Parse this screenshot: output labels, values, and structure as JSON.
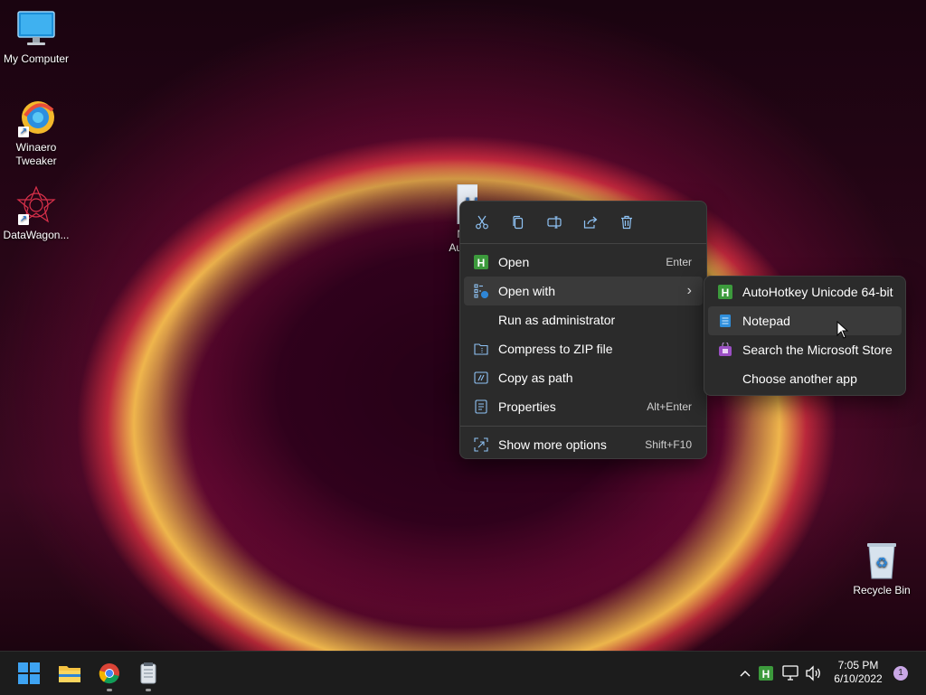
{
  "desktop": {
    "icons": [
      {
        "label": "My Computer",
        "icon": "monitor-icon"
      },
      {
        "label": "Winaero\nTweaker",
        "icon": "winaero-tweaker-icon"
      },
      {
        "label": "DataWagon...",
        "icon": "datawagon-icon"
      },
      {
        "label": "Recycle Bin",
        "icon": "recycle-bin-icon"
      }
    ],
    "selected_file": {
      "label_line1": "Ne",
      "label_line2": "AutoH",
      "icon": "autohotkey-file-icon"
    }
  },
  "context_menu": {
    "toolbar": [
      {
        "name": "cut",
        "icon": "scissors-icon"
      },
      {
        "name": "copy",
        "icon": "copy-icon"
      },
      {
        "name": "rename",
        "icon": "rename-icon"
      },
      {
        "name": "share",
        "icon": "share-icon"
      },
      {
        "name": "delete",
        "icon": "trash-icon"
      }
    ],
    "items": [
      {
        "label": "Open",
        "shortcut": "Enter"
      },
      {
        "label": "Open with",
        "shortcut": "›"
      },
      {
        "label": "Run as administrator",
        "shortcut": ""
      },
      {
        "label": "Compress to ZIP file",
        "shortcut": ""
      },
      {
        "label": "Copy as path",
        "shortcut": ""
      },
      {
        "label": "Properties",
        "shortcut": "Alt+Enter"
      },
      {
        "label": "Show more options",
        "shortcut": "Shift+F10"
      }
    ]
  },
  "submenu": {
    "items": [
      {
        "label": "AutoHotkey Unicode 64-bit"
      },
      {
        "label": "Notepad"
      },
      {
        "label": "Search the Microsoft Store"
      },
      {
        "label": "Choose another app"
      }
    ]
  },
  "taskbar": {
    "apps": [
      "start-icon",
      "file-explorer-icon",
      "chrome-icon",
      "notepad-app-icon"
    ],
    "clock": {
      "time": "7:05 PM",
      "date": "6/10/2022"
    },
    "notification_count": "1"
  },
  "colors": {
    "accent": "#0078d4",
    "menu_bg": "#2b2b2b",
    "ahk_green": "#3c9a3c"
  }
}
